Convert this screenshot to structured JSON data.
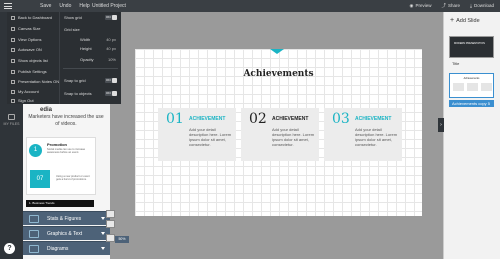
{
  "topbar": {
    "menu": [
      "Save",
      "Undo",
      "Help"
    ],
    "project_name": "Untitled Project",
    "actions": [
      {
        "label": "Preview",
        "icon": "eye-icon"
      },
      {
        "label": "Share",
        "icon": "share-icon"
      },
      {
        "label": "Download",
        "icon": "download-icon"
      }
    ]
  },
  "file_menu": {
    "items": [
      {
        "label": "Back to Dashboard",
        "icon": "home-icon"
      },
      {
        "label": "Canvas Size",
        "icon": "canvas-size-icon"
      },
      {
        "label": "View Options",
        "icon": "view-icon"
      },
      {
        "label": "Autosave",
        "toggle": "ON",
        "icon": "autosave-icon"
      },
      {
        "label": "Show objects list",
        "icon": "list-icon"
      },
      {
        "label": "Publish Settings",
        "icon": "publish-icon"
      },
      {
        "label": "Presentation Notes",
        "toggle": "ON",
        "icon": "notes-icon"
      },
      {
        "label": "My Account",
        "icon": "account-icon"
      },
      {
        "label": "Sign Out",
        "icon": "signout-icon"
      }
    ]
  },
  "view_options": {
    "show_grid": {
      "label": "Show grid",
      "toggle": "ON"
    },
    "grid_size_label": "Grid size",
    "width": {
      "label": "Width",
      "value": "40 px"
    },
    "height": {
      "label": "Height",
      "value": "40 px"
    },
    "opacity": {
      "label": "Opacity",
      "value": "10%"
    },
    "snap_to_grid": {
      "label": "Snap to grid",
      "toggle": "ON"
    },
    "snap_to_objects": {
      "label": "Snap to objects",
      "toggle": "ON"
    }
  },
  "rail": {
    "label": "MY FILES"
  },
  "left_panel": {
    "heading": "edia",
    "subtitle": "Marketers have increased the use of videos.",
    "preview": {
      "circle_number": "1",
      "title": "Promotion",
      "desc": "Social media can use to increase awareness before an event.",
      "box_number": "07",
      "desc2": "Using a new product or event gets a burst of promotions.",
      "bar_text": "1. Business Trends"
    },
    "categories": [
      {
        "label": "Stats & Figures",
        "icon": "stats-icon"
      },
      {
        "label": "Graphics & Text",
        "icon": "graphics-icon"
      },
      {
        "label": "Diagrams",
        "icon": "diagrams-icon"
      }
    ],
    "help": "?"
  },
  "slide": {
    "title": "Achievements",
    "cards": [
      {
        "num": "01",
        "title": "ACHIEVEMENT",
        "desc": "Add your detail description here. Lorem ipsum dolor sit amet, consectetur.",
        "style": "teal"
      },
      {
        "num": "02",
        "title": "ACHIEVEMENT",
        "desc": "Add your detail description here. Lorem ipsum dolor sit amet, consectetur.",
        "style": "dark"
      },
      {
        "num": "03",
        "title": "ACHIEVEMENT",
        "desc": "Add your detail description here. Lorem ipsum dolor sit amet, consectetur.",
        "style": "teal"
      }
    ],
    "accent_color": "#1ab4c4"
  },
  "zoom": "50%",
  "right_pane": {
    "add_slide": "Add Slide",
    "slides": [
      {
        "label": "Title",
        "thumb_text": "MODERN PRESENTATION"
      },
      {
        "label": "Achievements copy 5",
        "thumb_title": "Achievements"
      }
    ],
    "collapse": "›"
  }
}
